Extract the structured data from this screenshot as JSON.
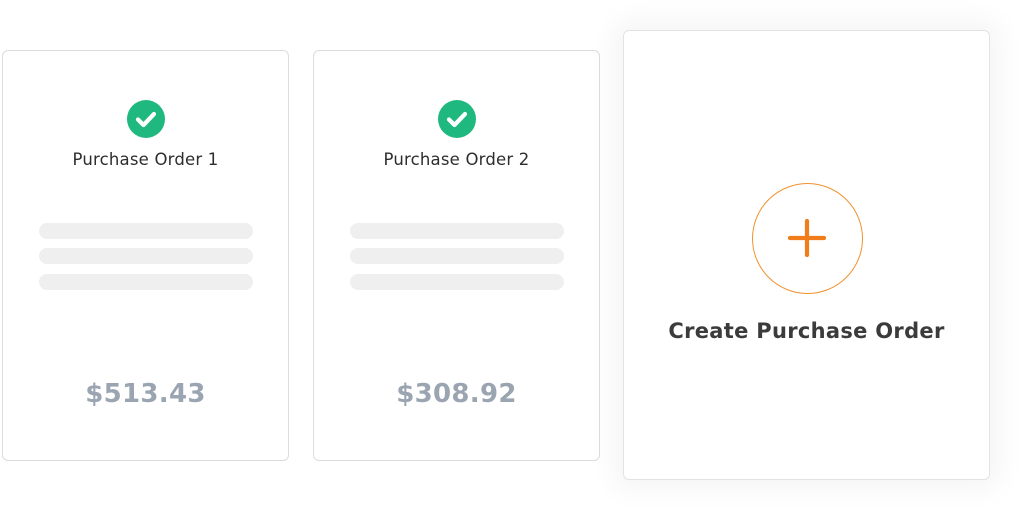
{
  "orders": [
    {
      "title": "Purchase Order 1",
      "amount": "$513.43",
      "status_icon": "check-circle-icon"
    },
    {
      "title": "Purchase Order 2",
      "amount": "$308.92",
      "status_icon": "check-circle-icon"
    }
  ],
  "create_card": {
    "label": "Create Purchase Order",
    "icon": "plus-icon"
  },
  "colors": {
    "success": "#1fb97f",
    "accent": "#f0922e",
    "amount_text": "#9aa5b1",
    "skeleton": "#efefef",
    "border": "#dcdcdc"
  }
}
